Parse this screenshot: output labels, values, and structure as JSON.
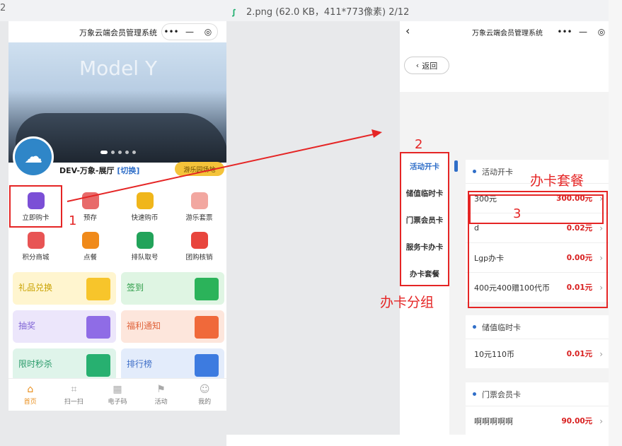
{
  "viewer": {
    "edge_left": "2",
    "title": "2.png (62.0 KB，411*773像素) 2/12"
  },
  "app_left": {
    "title": "万象云端会员管理系统",
    "capsule": {
      "more": "•••",
      "minimize": "—",
      "close": "◎"
    },
    "store_name": "DEV-万象-展厅",
    "switch": "[切换]",
    "visitor_btn": "游乐园场地",
    "grid": [
      {
        "label": "立即购卡",
        "color": "#7b4fd6",
        "icon": "card-icon"
      },
      {
        "label": "预存",
        "color": "#e86a6a",
        "icon": "wallet-icon"
      },
      {
        "label": "快速购币",
        "color": "#f0b61b",
        "icon": "coin-icon"
      },
      {
        "label": "游乐套票",
        "color": "#f2a7a0",
        "icon": "ticket-icon"
      },
      {
        "label": "积分商城",
        "color": "#e85454",
        "icon": "gift-icon"
      },
      {
        "label": "点餐",
        "color": "#f08a1a",
        "icon": "food-icon"
      },
      {
        "label": "排队取号",
        "color": "#22a35a",
        "icon": "queue-icon"
      },
      {
        "label": "团购核销",
        "color": "#e8453d",
        "icon": "group-icon"
      }
    ],
    "tiles": [
      {
        "label": "礼品兑换",
        "bg": "#fff5cf",
        "fg": "#c9a200",
        "deco": "#f7c52b"
      },
      {
        "label": "签到",
        "bg": "#dff5e3",
        "fg": "#2a9b45",
        "deco": "#2bb35a"
      },
      {
        "label": "抽奖",
        "bg": "#ece6fb",
        "fg": "#8065d6",
        "deco": "#8f6ce6"
      },
      {
        "label": "福利通知",
        "bg": "#fde6dc",
        "fg": "#e0643c",
        "deco": "#f0693a"
      },
      {
        "label": "限时秒杀",
        "bg": "#dff4ea",
        "fg": "#2a9b6a",
        "deco": "#27b070"
      },
      {
        "label": "排行榜",
        "bg": "#e3ecfb",
        "fg": "#3f6fc8",
        "deco": "#3d7be0"
      }
    ],
    "tabs": [
      {
        "label": "首页",
        "icon": "home-icon",
        "active": true
      },
      {
        "label": "扫一扫",
        "icon": "scan-icon",
        "active": false
      },
      {
        "label": "电子码",
        "icon": "qrcode-icon",
        "active": false
      },
      {
        "label": "活动",
        "icon": "flag-icon",
        "active": false
      },
      {
        "label": "我的",
        "icon": "user-icon",
        "active": false
      }
    ]
  },
  "app_right": {
    "title": "万象云端会员管理系统",
    "capsule": {
      "more": "•••",
      "minimize": "—",
      "close": "◎"
    },
    "back": "返回",
    "sidebar": [
      "活动开卡",
      "储值临时卡",
      "门票会员卡",
      "服务卡办卡",
      "办卡套餐"
    ],
    "sections": [
      {
        "title": "活动开卡",
        "rows": [
          {
            "name": "300元",
            "price": "300.00元"
          },
          {
            "name": "d",
            "price": "0.02元"
          },
          {
            "name": "Lgp办卡",
            "price": "0.00元"
          },
          {
            "name": "400元400赠100代币",
            "price": "0.01元"
          }
        ]
      },
      {
        "title": "储值临时卡",
        "rows": [
          {
            "name": "10元110币",
            "price": "0.01元"
          }
        ]
      },
      {
        "title": "门票会员卡",
        "rows": [
          {
            "name": "啊啊啊啊啊",
            "price": "90.00元"
          }
        ]
      }
    ]
  },
  "annotations": {
    "n1": "1",
    "n2": "2",
    "n3": "3",
    "group": "办卡分组",
    "package": "办卡套餐"
  }
}
